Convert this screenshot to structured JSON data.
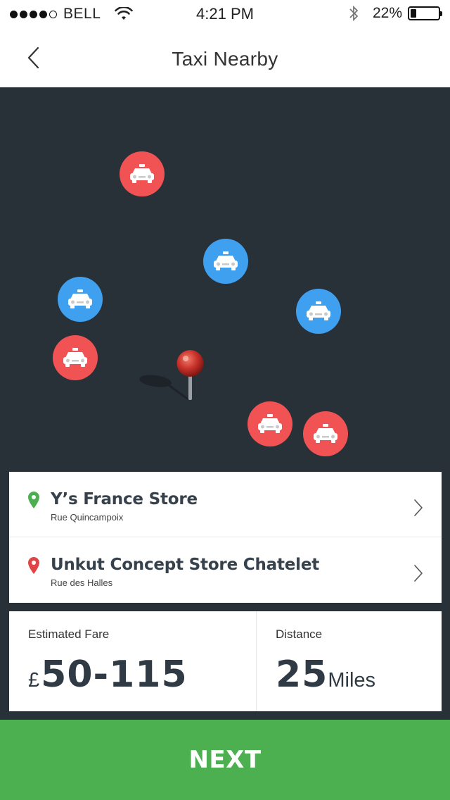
{
  "status_bar": {
    "carrier": "BELL",
    "time": "4:21 PM",
    "battery_percent": "22%",
    "battery_level": 0.22,
    "signal_bars_filled": 4,
    "signal_bars_total": 5
  },
  "nav": {
    "title": "Taxi Nearby",
    "back_icon": "chevron-left-icon"
  },
  "map": {
    "taxi_icon": "taxi-icon",
    "pin_icon": "map-pin-icon",
    "colors": {
      "red": "#f15354",
      "blue": "#3fa0f0",
      "background": "#283038"
    }
  },
  "route": {
    "origin": {
      "name": "Y’s France Store",
      "address": "Rue Quincampoix",
      "pin_color": "#4caf50"
    },
    "destination": {
      "name": "Unkut Concept Store Chatelet",
      "address": "Rue des Halles",
      "pin_color": "#e04444"
    }
  },
  "fare": {
    "label": "Estimated Fare",
    "currency": "£",
    "value": "50-115"
  },
  "distance": {
    "label": "Distance",
    "value": "25",
    "unit": "Miles"
  },
  "next_button": {
    "label": "NEXT",
    "color": "#4caf50"
  }
}
